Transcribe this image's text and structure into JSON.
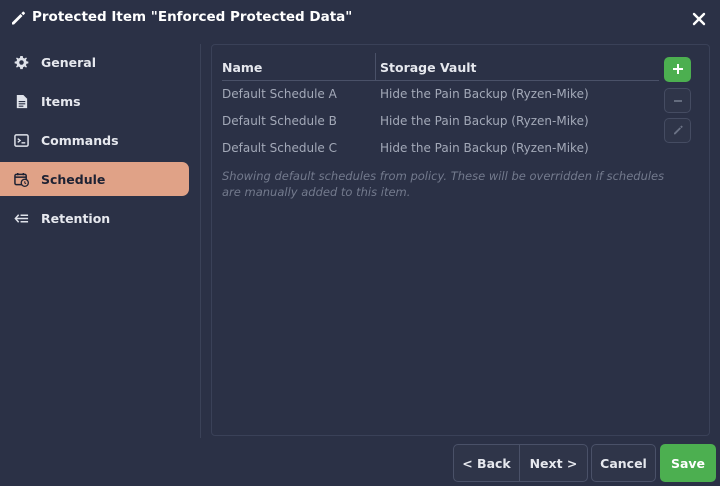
{
  "window": {
    "title": "Protected Item \"Enforced Protected Data\"",
    "title_icon": "pencil-icon",
    "close_icon": "close-icon"
  },
  "sidebar": {
    "items": [
      {
        "label": "General",
        "icon": "gear-icon",
        "active": false
      },
      {
        "label": "Items",
        "icon": "document-icon",
        "active": false
      },
      {
        "label": "Commands",
        "icon": "terminal-icon",
        "active": false
      },
      {
        "label": "Schedule",
        "icon": "calendar-clock-icon",
        "active": true
      },
      {
        "label": "Retention",
        "icon": "retention-icon",
        "active": false
      }
    ]
  },
  "schedule": {
    "columns": [
      "Name",
      "Storage Vault"
    ],
    "rows": [
      {
        "name": "Default Schedule A",
        "vault": "Hide the Pain Backup (Ryzen-Mike)"
      },
      {
        "name": "Default Schedule B",
        "vault": "Hide the Pain Backup (Ryzen-Mike)"
      },
      {
        "name": "Default Schedule C",
        "vault": "Hide the Pain Backup (Ryzen-Mike)"
      }
    ],
    "note": "Showing default schedules from policy. These will be overridden if schedules are manually added to this item.",
    "buttons": {
      "add_icon": "plus-icon",
      "remove_icon": "minus-icon",
      "edit_icon": "pencil-icon"
    }
  },
  "footer": {
    "back_label": "< Back",
    "next_label": "Next >",
    "cancel_label": "Cancel",
    "save_label": "Save"
  },
  "colors": {
    "background": "#2b3146",
    "active_tab": "#e0a287",
    "accent_green": "#4caf50"
  }
}
